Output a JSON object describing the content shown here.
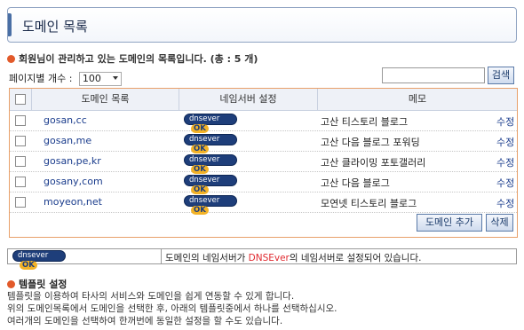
{
  "header": {
    "title": "도메인 목록"
  },
  "summary": {
    "text": "회원님이 관리하고 있는 도메인의 목록입니다. (총 : 5 개)"
  },
  "per_page": {
    "label": "페이지별 개수 :",
    "value": "100"
  },
  "search": {
    "placeholder": "",
    "button": "검색"
  },
  "table": {
    "headers": [
      "도메인 목록",
      "네임서버 설정",
      "메모"
    ],
    "rows": [
      {
        "domain": "gosan,cc",
        "memo": "고산 티스토리 블로그",
        "edit": "수정"
      },
      {
        "domain": "gosan,me",
        "memo": "고산 다음 블로그 포워딩",
        "edit": "수정"
      },
      {
        "domain": "gosan,pe,kr",
        "memo": "고산 클라이밍 포토갤러리",
        "edit": "수정"
      },
      {
        "domain": "gosany,com",
        "memo": "고산 다음 블로그",
        "edit": "수정"
      },
      {
        "domain": "moyeon,net",
        "memo": "모연넷 티스토리 블로그",
        "edit": "수정"
      }
    ],
    "dns_badge": {
      "text": "dnsever",
      "ok": "OK"
    }
  },
  "actions": {
    "add": "도메인 추가",
    "delete": "삭제"
  },
  "legend": {
    "badge": "dnsever",
    "ok": "OK",
    "before": "도메인의 네임서버가 ",
    "highlight": "DNSEver",
    "after": "의 네임서버로 설정되어 있습니다."
  },
  "template": {
    "title": "템플릿 설정",
    "lines": [
      "템플릿을 이용하여 타사의 서비스와 도메인을 쉽게 연동할 수 있게 합니다.",
      "위의 도메인목록에서 도메인을 선택한 후, 아래의 템플릿중에서 하나를 선택하십시오.",
      "여러개의 도메인을 선택하여 한꺼번에 동일한 설정을 할 수도 있습니다."
    ]
  },
  "colors": {
    "accent": "#4a6fa5",
    "badge": "#1e3e7a",
    "badge_ok": "#f2b227",
    "highlight": "#e0292f",
    "link": "#1a3c8c"
  }
}
